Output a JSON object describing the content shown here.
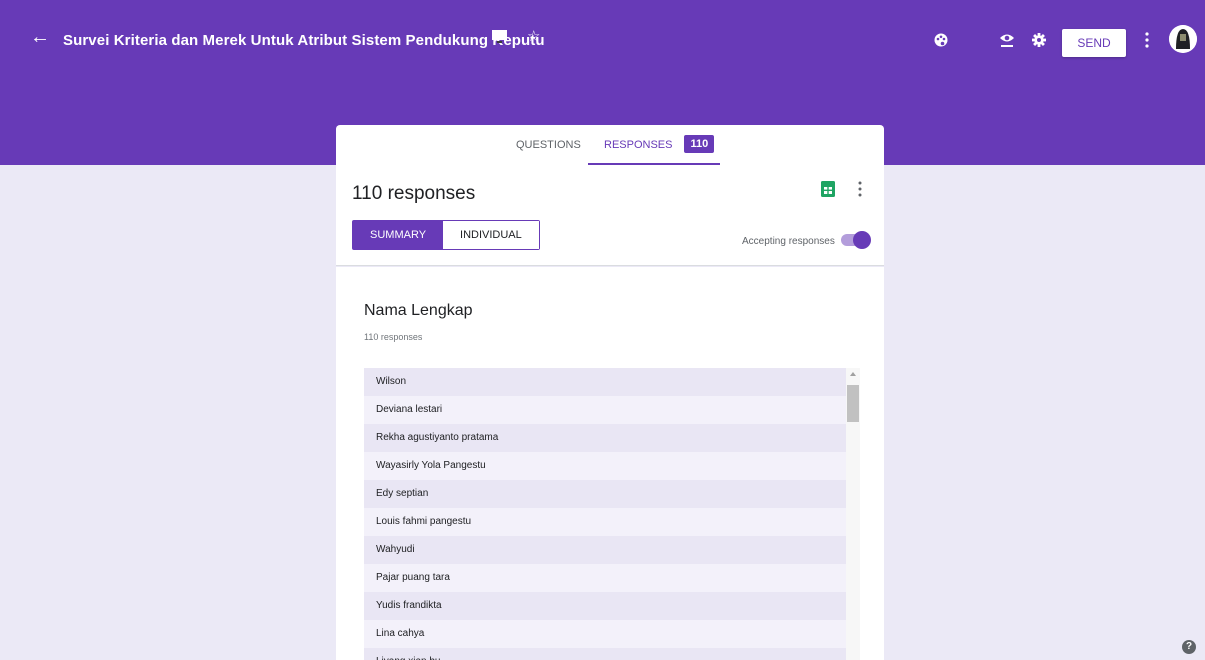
{
  "header": {
    "back_icon": "arrow-left-icon",
    "title": "Survei Kriteria dan Merek Untuk Atribut Sistem Pendukung Keputu",
    "send_label": "SEND",
    "icons": [
      "folder-icon",
      "star-icon",
      "palette-icon",
      "eye-icon",
      "gear-icon",
      "more-vert-icon"
    ],
    "brand_color": "#673ab7"
  },
  "tabs": {
    "questions_label": "QUESTIONS",
    "responses_label": "RESPONSES",
    "responses_count": "110"
  },
  "summary": {
    "count_text": "110 responses",
    "view_summary_label": "SUMMARY",
    "view_individual_label": "INDIVIDUAL",
    "accepting_label": "Accepting responses",
    "accepting_on": true
  },
  "question": {
    "title": "Nama Lengkap",
    "subtitle": "110 responses",
    "answers": [
      "Wilson",
      "Deviana lestari",
      "Rekha agustiyanto pratama",
      "Wayasirly Yola Pangestu",
      "Edy septian",
      "Louis fahmi pangestu",
      "Wahyudi",
      "Pajar puang tara",
      "Yudis frandikta",
      "Lina cahya",
      "Liyang xian bu"
    ]
  }
}
